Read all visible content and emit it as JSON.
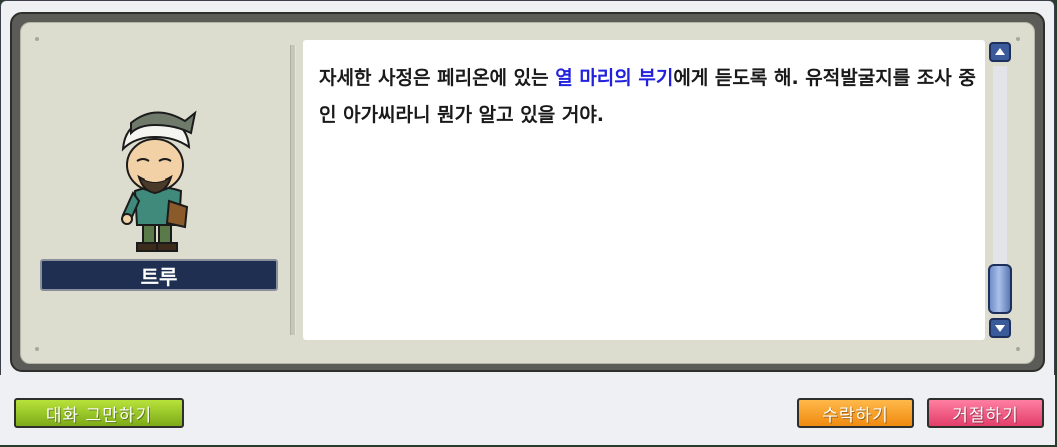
{
  "npc": {
    "name": "트루"
  },
  "dialog": {
    "text_before": "자세한 사정은 페리온에 있는 ",
    "highlight": "열 마리의 부기",
    "text_after": "에게 듣도록 해. 유적발굴지를 조사 중인 아가씨라니 뭔가 알고 있을 거야.",
    "highlight_color": "#2222dd"
  },
  "buttons": {
    "end_chat": "대화 그만하기",
    "accept": "수락하기",
    "decline": "거절하기"
  },
  "icons": {
    "scroll_up": "scroll-up-arrow-icon",
    "scroll_down": "scroll-down-arrow-icon"
  },
  "colors": {
    "nameplate": "#1f2f52",
    "end_chat_button": "#9bc82a",
    "accept_button": "#f4a12c",
    "decline_button": "#ef5a84"
  }
}
